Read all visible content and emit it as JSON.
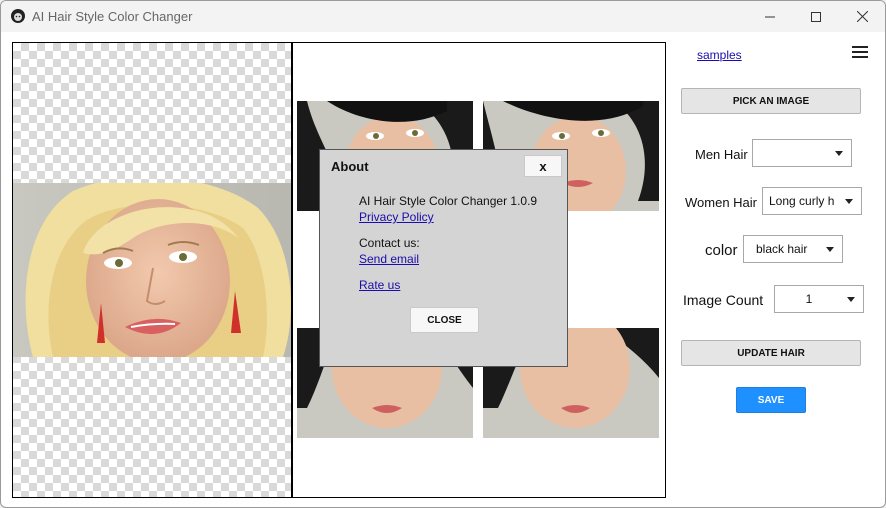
{
  "window": {
    "title": "AI Hair Style Color Changer",
    "icon": "app-face-icon",
    "controls": [
      "minimize-icon",
      "maximize-icon",
      "close-icon"
    ]
  },
  "panel": {
    "samples_link": "samples",
    "menu_icon": "hamburger-icon",
    "pick_image": "PICK AN IMAGE",
    "men_hair": {
      "label": "Men Hair",
      "value": ""
    },
    "women_hair": {
      "label": "Women Hair",
      "value": "Long curly h"
    },
    "color": {
      "label": "color",
      "value": "black hair"
    },
    "image_count": {
      "label": "Image Count",
      "value": "1"
    },
    "update_hair": "UPDATE HAIR",
    "save": "SAVE"
  },
  "dialog": {
    "title": "About",
    "close_x": "x",
    "app_version": "AI Hair Style Color Changer 1.0.9",
    "privacy_link": "Privacy Policy",
    "contact_label": "Contact us:",
    "email_link": "Send email",
    "rate_link": "Rate us",
    "close_button": "CLOSE"
  },
  "colors": {
    "save_button": "#1e90ff",
    "link": "#1a0dab",
    "dialog_bg": "#d4d4d4"
  }
}
